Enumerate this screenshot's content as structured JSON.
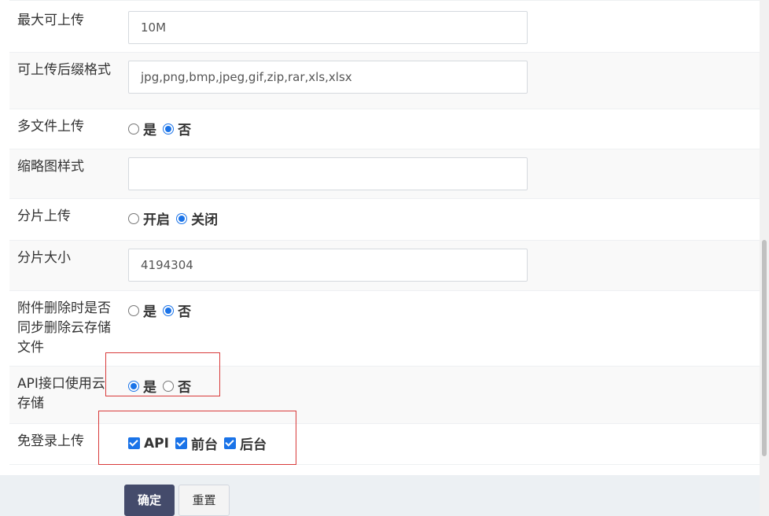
{
  "form": {
    "max_upload": {
      "label": "最大可上传",
      "value": "10M"
    },
    "allowed_suffix": {
      "label": "可上传后缀格式",
      "value": "jpg,png,bmp,jpeg,gif,zip,rar,xls,xlsx"
    },
    "multi_upload": {
      "label": "多文件上传",
      "options": [
        "是",
        "否"
      ],
      "selected": "否"
    },
    "thumb_style": {
      "label": "缩略图样式",
      "value": ""
    },
    "chunk_upload": {
      "label": "分片上传",
      "options": [
        "开启",
        "关闭"
      ],
      "selected": "关闭"
    },
    "chunk_size": {
      "label": "分片大小",
      "value": "4194304"
    },
    "sync_delete": {
      "label": "附件删除时是否同步删除云存储文件",
      "options": [
        "是",
        "否"
      ],
      "selected": "否"
    },
    "api_cloud": {
      "label": "API接口使用云存储",
      "options": [
        "是",
        "否"
      ],
      "selected": "是"
    },
    "nologin_upload": {
      "label": "免登录上传",
      "options": [
        "API",
        "前台",
        "后台"
      ],
      "checked": [
        "API",
        "前台",
        "后台"
      ]
    }
  },
  "buttons": {
    "submit": "确定",
    "reset": "重置"
  },
  "colors": {
    "accent": "#1a73e8",
    "primary_button": "#444b6b",
    "highlight": "#d83a3a"
  }
}
